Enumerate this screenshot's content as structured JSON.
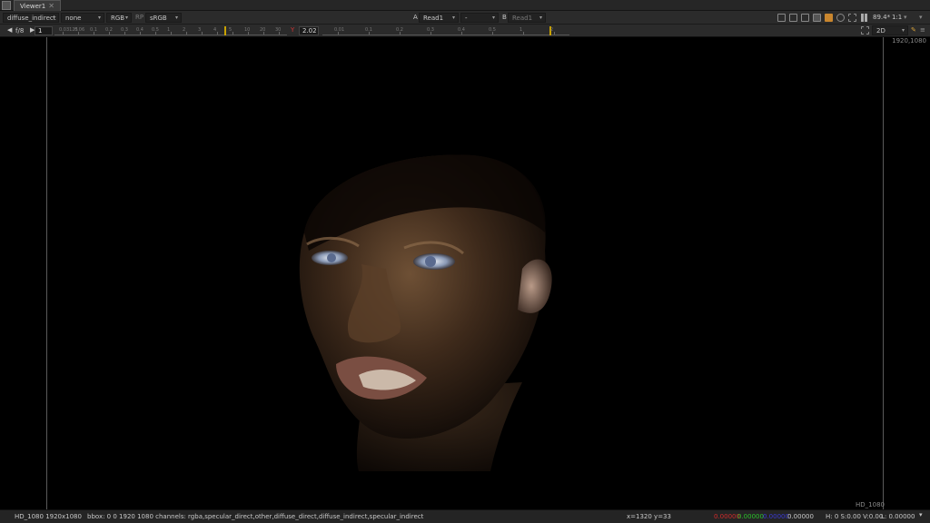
{
  "tab": {
    "title": "Viewer1",
    "close": "✕"
  },
  "toolbar": {
    "layer": "diffuse_indirect",
    "alpha": "none",
    "display_channels": "RGB",
    "proxy_label": "RP",
    "colorspace": "sRGB",
    "input_a_letter": "A",
    "input_a": "Read1",
    "wipe_op": "-",
    "input_b_letter": "B",
    "input_b": "Read1",
    "zoom": "89.4*",
    "ratio": "1:1"
  },
  "timeline": {
    "fstop": "f/8",
    "frame": "1",
    "gain_label": "Y",
    "gain_value": "2.02",
    "view_mode": "2D",
    "left_ticks": [
      "0.03125",
      "0.06",
      "0.1",
      "0.2",
      "0.3",
      "0.4",
      "0.5",
      "1",
      "2",
      "3",
      "4",
      "5",
      "10",
      "20",
      "30"
    ],
    "right_ticks": [
      "0.01",
      "0.1",
      "0.2",
      "0.3",
      "0.4",
      "0.5",
      "1",
      "2"
    ],
    "gain_fraction": 0.73,
    "gamma_fraction": 0.92
  },
  "viewer": {
    "format_top_right": "1920,1080",
    "format_bottom_right": "HD_1080"
  },
  "status": {
    "format": "HD_1080 1920x1080",
    "bbox": "bbox: 0 0 1920 1080 channels: rgba,specular_direct,other,diffuse_direct,diffuse_indirect,specular_indirect",
    "coords": "x=1320 y=33",
    "r": "0.00000",
    "g": "0.00000",
    "b": "0.00000",
    "a": "0.00000",
    "hsv": "H:   0 S:0.00 V:0.00",
    "lum": "L: 0.00000",
    "colors": {
      "r": "#d22b2b",
      "g": "#2bc22b",
      "b": "#3b3bd6"
    }
  },
  "icons": {
    "view_buttons": [
      "roi-icon",
      "rect-icon",
      "clip-icon",
      "overlay-icon",
      "lut-icon",
      "refresh-icon",
      "capture-icon",
      "pause-icon",
      "gpu-icon"
    ],
    "right_icons": [
      "viewer-2d-icon",
      "paint-icon",
      "menu-icon"
    ]
  }
}
